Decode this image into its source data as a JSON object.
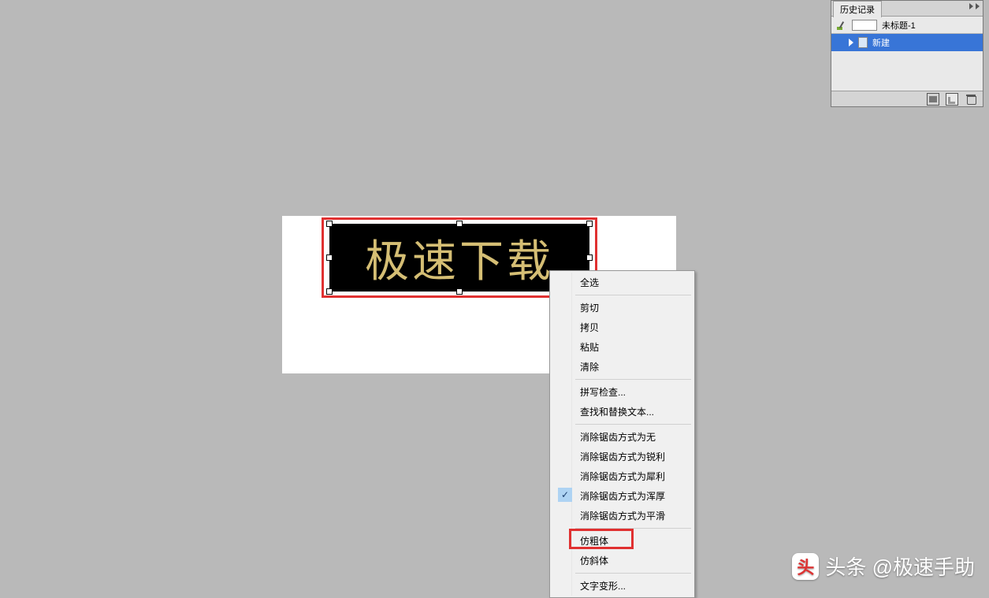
{
  "canvas": {
    "text": "极速下载"
  },
  "context_menu": {
    "items": [
      {
        "label": "全选"
      },
      {
        "label": "剪切"
      },
      {
        "label": "拷贝"
      },
      {
        "label": "粘贴"
      },
      {
        "label": "清除"
      },
      {
        "label": "拼写检查..."
      },
      {
        "label": "查找和替换文本..."
      },
      {
        "label": "消除锯齿方式为无"
      },
      {
        "label": "消除锯齿方式为锐利"
      },
      {
        "label": "消除锯齿方式为犀利"
      },
      {
        "label": "消除锯齿方式为浑厚",
        "checked": true
      },
      {
        "label": "消除锯齿方式为平滑"
      },
      {
        "label": "仿粗体",
        "highlight": true
      },
      {
        "label": "仿斜体"
      },
      {
        "label": "文字变形..."
      }
    ]
  },
  "history_panel": {
    "tab_label": "历史记录",
    "document_name": "未标题-1",
    "entry": "新建"
  },
  "watermark": {
    "text": "头条 @极速手助"
  }
}
